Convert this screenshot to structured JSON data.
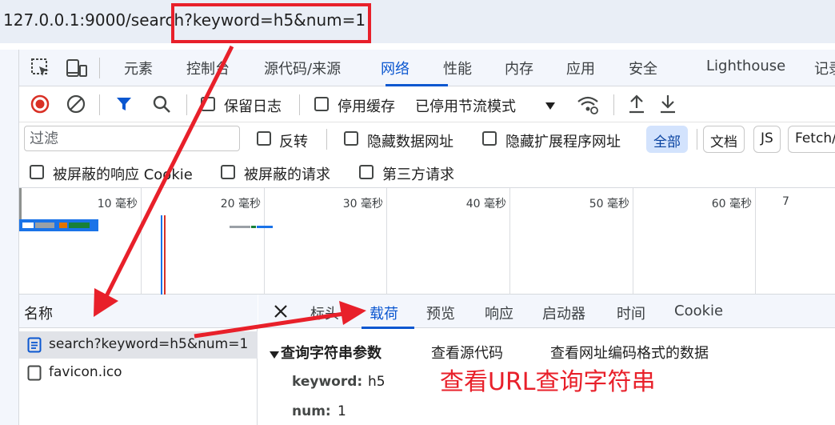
{
  "address_bar": {
    "url_base": "127.0.0.1:9000/search",
    "url_query": "?keyword=h5&num=1"
  },
  "panel_tabs": [
    "元素",
    "控制台",
    "源代码/来源",
    "网络",
    "性能",
    "内存",
    "应用",
    "安全",
    "Lighthouse",
    "记录"
  ],
  "active_panel_tab": "网络",
  "toolbar": {
    "preserve_log": "保留日志",
    "disable_cache": "停用缓存",
    "throttling": "已停用节流模式"
  },
  "filter": {
    "placeholder": "过滤",
    "invert": "反转",
    "hide_data_urls": "隐藏数据网址",
    "hide_extension_urls": "隐藏扩展程序网址",
    "types": [
      "全部",
      "文档",
      "JS",
      "Fetch/"
    ],
    "active_type": "全部"
  },
  "options_row": {
    "blocked_cookies": "被屏蔽的响应 Cookie",
    "blocked_requests": "被屏蔽的请求",
    "third_party": "第三方请求"
  },
  "timeline": {
    "ticks": [
      "10 毫秒",
      "20 毫秒",
      "30 毫秒",
      "40 毫秒",
      "50 毫秒",
      "60 毫秒",
      "7"
    ]
  },
  "requests": {
    "column_name": "名称",
    "items": [
      {
        "name": "search?keyword=h5&num=1",
        "selected": true,
        "icon": "document-icon"
      },
      {
        "name": "favicon.ico",
        "selected": false,
        "icon": "file-icon"
      }
    ]
  },
  "details": {
    "tabs": [
      "标头",
      "载荷",
      "预览",
      "响应",
      "启动器",
      "时间",
      "Cookie"
    ],
    "active_tab": "载荷",
    "section_title": "查询字符串参数",
    "view_source": "查看源代码",
    "view_url_encoded": "查看网址编码格式的数据",
    "params": [
      {
        "key": "keyword:",
        "value": "h5"
      },
      {
        "key": "num:",
        "value": "1"
      }
    ]
  },
  "annotation": "查看URL查询字符串",
  "colors": {
    "accent_blue": "#0b57d0",
    "annotation_red": "#e8202a",
    "record_red": "#d93025"
  }
}
